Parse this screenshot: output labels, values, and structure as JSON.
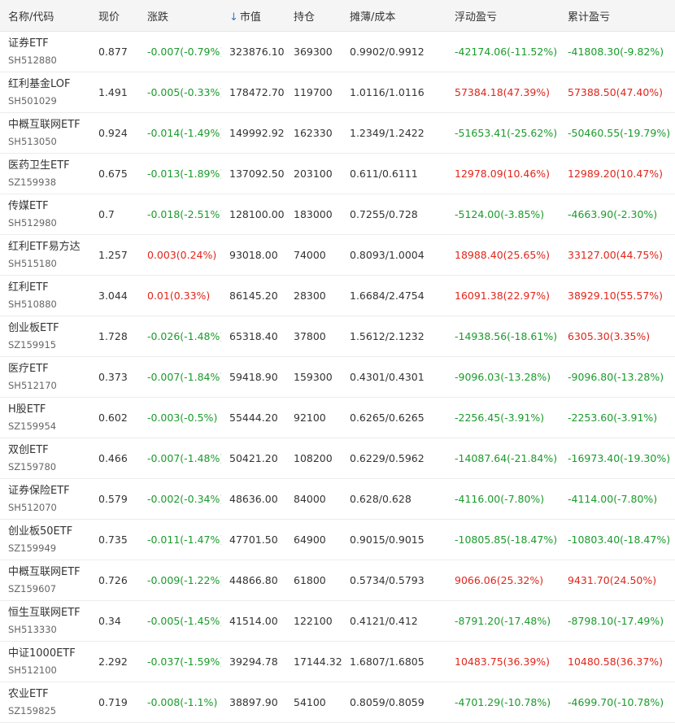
{
  "colors": {
    "up": "#e0261b",
    "down": "#1a9b2b",
    "sort": "#2d7bd6"
  },
  "header": {
    "name_code": "名称/代码",
    "price": "现价",
    "change": "涨跌",
    "sort_icon": "↓",
    "sort_icon_name": "arrow-down-icon",
    "market_value": "市值",
    "position": "持仓",
    "cost": "摊薄/成本",
    "float_pl": "浮动盈亏",
    "acc_pl": "累计盈亏"
  },
  "rows": [
    {
      "name": "证券ETF",
      "code": "SH512880",
      "price": "0.877",
      "change": "-0.007(-0.79%)",
      "change_dir": "down",
      "market_value": "323876.10",
      "position": "369300",
      "cost": "0.9902/0.9912",
      "float_pl": "-42174.06(-11.52%)",
      "float_dir": "down",
      "acc_pl": "-41808.30(-9.82%)",
      "acc_dir": "down"
    },
    {
      "name": "红利基金LOF",
      "code": "SH501029",
      "price": "1.491",
      "change": "-0.005(-0.33%)",
      "change_dir": "down",
      "market_value": "178472.70",
      "position": "119700",
      "cost": "1.0116/1.0116",
      "float_pl": "57384.18(47.39%)",
      "float_dir": "up",
      "acc_pl": "57388.50(47.40%)",
      "acc_dir": "up"
    },
    {
      "name": "中概互联网ETF",
      "code": "SH513050",
      "price": "0.924",
      "change": "-0.014(-1.49%)",
      "change_dir": "down",
      "market_value": "149992.92",
      "position": "162330",
      "cost": "1.2349/1.2422",
      "float_pl": "-51653.41(-25.62%)",
      "float_dir": "down",
      "acc_pl": "-50460.55(-19.79%)",
      "acc_dir": "down"
    },
    {
      "name": "医药卫生ETF",
      "code": "SZ159938",
      "price": "0.675",
      "change": "-0.013(-1.89%)",
      "change_dir": "down",
      "market_value": "137092.50",
      "position": "203100",
      "cost": "0.611/0.6111",
      "float_pl": "12978.09(10.46%)",
      "float_dir": "up",
      "acc_pl": "12989.20(10.47%)",
      "acc_dir": "up"
    },
    {
      "name": "传媒ETF",
      "code": "SH512980",
      "price": "0.7",
      "change": "-0.018(-2.51%)",
      "change_dir": "down",
      "market_value": "128100.00",
      "position": "183000",
      "cost": "0.7255/0.728",
      "float_pl": "-5124.00(-3.85%)",
      "float_dir": "down",
      "acc_pl": "-4663.90(-2.30%)",
      "acc_dir": "down"
    },
    {
      "name": "红利ETF易方达",
      "code": "SH515180",
      "price": "1.257",
      "change": "0.003(0.24%)",
      "change_dir": "up",
      "market_value": "93018.00",
      "position": "74000",
      "cost": "0.8093/1.0004",
      "float_pl": "18988.40(25.65%)",
      "float_dir": "up",
      "acc_pl": "33127.00(44.75%)",
      "acc_dir": "up"
    },
    {
      "name": "红利ETF",
      "code": "SH510880",
      "price": "3.044",
      "change": "0.01(0.33%)",
      "change_dir": "up",
      "market_value": "86145.20",
      "position": "28300",
      "cost": "1.6684/2.4754",
      "float_pl": "16091.38(22.97%)",
      "float_dir": "up",
      "acc_pl": "38929.10(55.57%)",
      "acc_dir": "up"
    },
    {
      "name": "创业板ETF",
      "code": "SZ159915",
      "price": "1.728",
      "change": "-0.026(-1.48%)",
      "change_dir": "down",
      "market_value": "65318.40",
      "position": "37800",
      "cost": "1.5612/2.1232",
      "float_pl": "-14938.56(-18.61%)",
      "float_dir": "down",
      "acc_pl": "6305.30(3.35%)",
      "acc_dir": "up"
    },
    {
      "name": "医疗ETF",
      "code": "SH512170",
      "price": "0.373",
      "change": "-0.007(-1.84%)",
      "change_dir": "down",
      "market_value": "59418.90",
      "position": "159300",
      "cost": "0.4301/0.4301",
      "float_pl": "-9096.03(-13.28%)",
      "float_dir": "down",
      "acc_pl": "-9096.80(-13.28%)",
      "acc_dir": "down"
    },
    {
      "name": "H股ETF",
      "code": "SZ159954",
      "price": "0.602",
      "change": "-0.003(-0.5%)",
      "change_dir": "down",
      "market_value": "55444.20",
      "position": "92100",
      "cost": "0.6265/0.6265",
      "float_pl": "-2256.45(-3.91%)",
      "float_dir": "down",
      "acc_pl": "-2253.60(-3.91%)",
      "acc_dir": "down"
    },
    {
      "name": "双创ETF",
      "code": "SZ159780",
      "price": "0.466",
      "change": "-0.007(-1.48%)",
      "change_dir": "down",
      "market_value": "50421.20",
      "position": "108200",
      "cost": "0.6229/0.5962",
      "float_pl": "-14087.64(-21.84%)",
      "float_dir": "down",
      "acc_pl": "-16973.40(-19.30%)",
      "acc_dir": "down"
    },
    {
      "name": "证券保险ETF",
      "code": "SH512070",
      "price": "0.579",
      "change": "-0.002(-0.34%)",
      "change_dir": "down",
      "market_value": "48636.00",
      "position": "84000",
      "cost": "0.628/0.628",
      "float_pl": "-4116.00(-7.80%)",
      "float_dir": "down",
      "acc_pl": "-4114.00(-7.80%)",
      "acc_dir": "down"
    },
    {
      "name": "创业板50ETF",
      "code": "SZ159949",
      "price": "0.735",
      "change": "-0.011(-1.47%)",
      "change_dir": "down",
      "market_value": "47701.50",
      "position": "64900",
      "cost": "0.9015/0.9015",
      "float_pl": "-10805.85(-18.47%)",
      "float_dir": "down",
      "acc_pl": "-10803.40(-18.47%)",
      "acc_dir": "down"
    },
    {
      "name": "中概互联网ETF",
      "code": "SZ159607",
      "price": "0.726",
      "change": "-0.009(-1.22%)",
      "change_dir": "down",
      "market_value": "44866.80",
      "position": "61800",
      "cost": "0.5734/0.5793",
      "float_pl": "9066.06(25.32%)",
      "float_dir": "up",
      "acc_pl": "9431.70(24.50%)",
      "acc_dir": "up"
    },
    {
      "name": "恒生互联网ETF",
      "code": "SH513330",
      "price": "0.34",
      "change": "-0.005(-1.45%)",
      "change_dir": "down",
      "market_value": "41514.00",
      "position": "122100",
      "cost": "0.4121/0.412",
      "float_pl": "-8791.20(-17.48%)",
      "float_dir": "down",
      "acc_pl": "-8798.10(-17.49%)",
      "acc_dir": "down"
    },
    {
      "name": "中证1000ETF",
      "code": "SH512100",
      "price": "2.292",
      "change": "-0.037(-1.59%)",
      "change_dir": "down",
      "market_value": "39294.78",
      "position": "17144.32",
      "cost": "1.6807/1.6805",
      "float_pl": "10483.75(36.39%)",
      "float_dir": "up",
      "acc_pl": "10480.58(36.37%)",
      "acc_dir": "up"
    },
    {
      "name": "农业ETF",
      "code": "SZ159825",
      "price": "0.719",
      "change": "-0.008(-1.1%)",
      "change_dir": "down",
      "market_value": "38897.90",
      "position": "54100",
      "cost": "0.8059/0.8059",
      "float_pl": "-4701.29(-10.78%)",
      "float_dir": "down",
      "acc_pl": "-4699.70(-10.78%)",
      "acc_dir": "down"
    }
  ]
}
